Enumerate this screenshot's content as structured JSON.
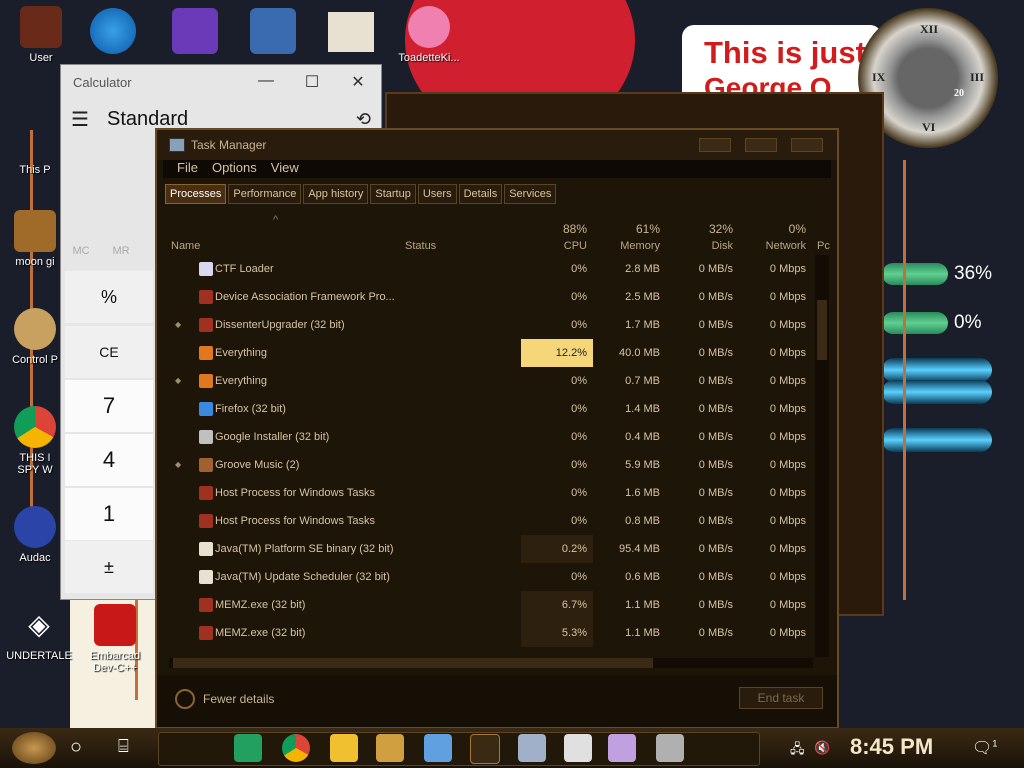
{
  "desktop": {
    "banner_line1": "This is just",
    "banner_line2": "George O",
    "clock_date": "20",
    "meter_cpu": "36%",
    "meter_mem": "0%",
    "icons": [
      {
        "label": "User"
      },
      {
        "label": "This P"
      },
      {
        "label": "moon gi"
      },
      {
        "label": "Control P"
      },
      {
        "label": "THIS I SPY W"
      },
      {
        "label": "Audac"
      },
      {
        "label": "UNDERTALE"
      },
      {
        "label": "Embarcad Dev-C++"
      },
      {
        "label": "ToadetteKi..."
      }
    ]
  },
  "calculator": {
    "title": "Calculator",
    "mode": "Standard",
    "window_controls": [
      "—",
      "☐",
      "✕"
    ],
    "menu_icon": "☰",
    "history_icon": "⟲",
    "memory": [
      "MC",
      "MR"
    ],
    "keys": [
      "%",
      "CE",
      "7",
      "4",
      "1",
      "±"
    ]
  },
  "taskmanager": {
    "title": "Task Manager",
    "menu": [
      "File",
      "Options",
      "View"
    ],
    "tabs": [
      "Processes",
      "Performance",
      "App history",
      "Startup",
      "Users",
      "Details",
      "Services"
    ],
    "sort_indicator": "^",
    "columns": {
      "name": "Name",
      "status": "Status",
      "cpu_pct": "88%",
      "cpu": "CPU",
      "memory_pct": "61%",
      "memory": "Memory",
      "disk_pct": "32%",
      "disk": "Disk",
      "network_pct": "0%",
      "network": "Network",
      "power": "Pc"
    },
    "processes": [
      {
        "name": "CTF Loader",
        "cpu": "0%",
        "memory": "2.8 MB",
        "disk": "0 MB/s",
        "network": "0 Mbps",
        "icon": "ctf-loader-icon",
        "expand": false
      },
      {
        "name": "Device Association Framework Pro...",
        "cpu": "0%",
        "memory": "2.5 MB",
        "disk": "0 MB/s",
        "network": "0 Mbps",
        "icon": "app-icon",
        "expand": false
      },
      {
        "name": "DissenterUpgrader (32 bit)",
        "cpu": "0%",
        "memory": "1.7 MB",
        "disk": "0 MB/s",
        "network": "0 Mbps",
        "icon": "app-icon",
        "expand": true
      },
      {
        "name": "Everything",
        "cpu": "12.2%",
        "memory": "40.0 MB",
        "disk": "0 MB/s",
        "network": "0 Mbps",
        "icon": "magnifier-icon",
        "expand": false,
        "hot": true
      },
      {
        "name": "Everything",
        "cpu": "0%",
        "memory": "0.7 MB",
        "disk": "0 MB/s",
        "network": "0 Mbps",
        "icon": "magnifier-icon",
        "expand": true
      },
      {
        "name": "Firefox (32 bit)",
        "cpu": "0%",
        "memory": "1.4 MB",
        "disk": "0 MB/s",
        "network": "0 Mbps",
        "icon": "firefox-icon",
        "expand": false
      },
      {
        "name": "Google Installer (32 bit)",
        "cpu": "0%",
        "memory": "0.4 MB",
        "disk": "0 MB/s",
        "network": "0 Mbps",
        "icon": "installer-icon",
        "expand": false
      },
      {
        "name": "Groove Music (2)",
        "cpu": "0%",
        "memory": "5.9 MB",
        "disk": "0 MB/s",
        "network": "0 Mbps",
        "icon": "groove-icon",
        "expand": true
      },
      {
        "name": "Host Process for Windows Tasks",
        "cpu": "0%",
        "memory": "1.6 MB",
        "disk": "0 MB/s",
        "network": "0 Mbps",
        "icon": "app-icon",
        "expand": false
      },
      {
        "name": "Host Process for Windows Tasks",
        "cpu": "0%",
        "memory": "0.8 MB",
        "disk": "0 MB/s",
        "network": "0 Mbps",
        "icon": "app-icon",
        "expand": false
      },
      {
        "name": "Java(TM) Platform SE binary (32 bit)",
        "cpu": "0.2%",
        "memory": "95.4 MB",
        "disk": "0 MB/s",
        "network": "0 Mbps",
        "icon": "java-icon",
        "expand": false,
        "warm": true
      },
      {
        "name": "Java(TM) Update Scheduler (32 bit)",
        "cpu": "0%",
        "memory": "0.6 MB",
        "disk": "0 MB/s",
        "network": "0 Mbps",
        "icon": "java-icon",
        "expand": false
      },
      {
        "name": "MEMZ.exe (32 bit)",
        "cpu": "6.7%",
        "memory": "1.1 MB",
        "disk": "0 MB/s",
        "network": "0 Mbps",
        "icon": "app-icon",
        "expand": false,
        "warm": true
      },
      {
        "name": "MEMZ.exe (32 bit)",
        "cpu": "5.3%",
        "memory": "1.1 MB",
        "disk": "0 MB/s",
        "network": "0 Mbps",
        "icon": "app-icon",
        "expand": false,
        "warm": true
      }
    ],
    "fewer_details": "Fewer details",
    "end_task": "End task"
  },
  "taskbar": {
    "time": "8:45 PM",
    "search_icon": "○",
    "taskview_icon": "⌸",
    "notify_icon": "🗨",
    "notify_count": "1",
    "pinned": [
      "sheets-icon",
      "chrome-icon",
      "explorer-icon",
      "game-icon",
      "photos-icon",
      "undertale-icon",
      "notes-icon",
      "calculator-icon",
      "paint-icon",
      "monitor-icon"
    ]
  },
  "colors": {
    "tm_bg": "#1e1509",
    "tm_text": "#d6c4a4",
    "hot_cell": "#f5d77a",
    "calc_bg": "#e6e6e6"
  }
}
